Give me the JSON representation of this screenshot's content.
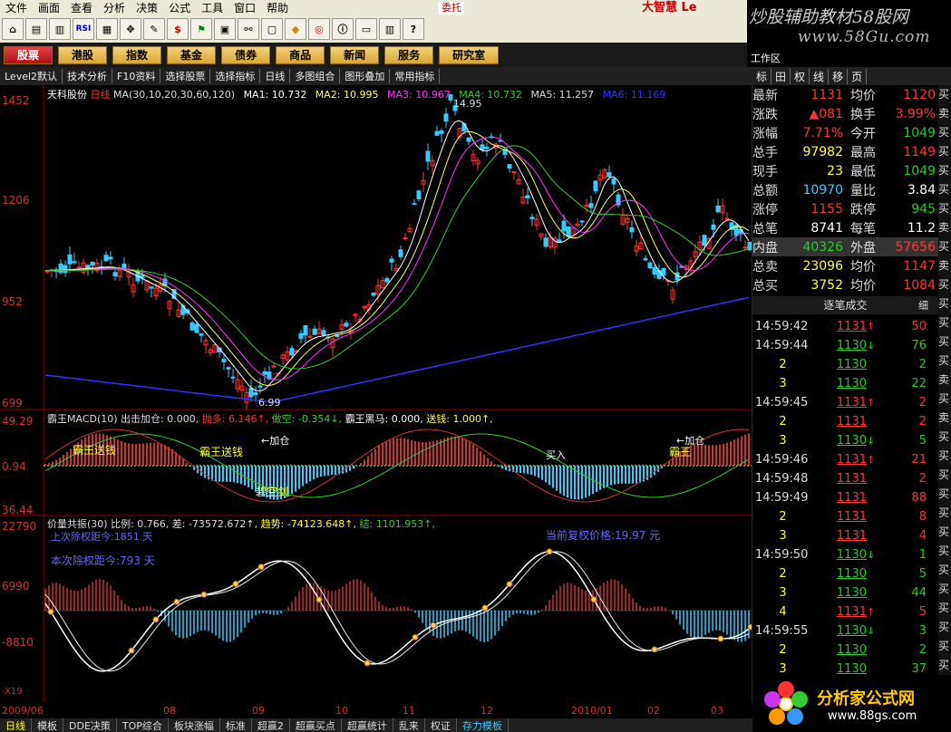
{
  "menu": [
    "文件",
    "画面",
    "查看",
    "分析",
    "决策",
    "公式",
    "工具",
    "窗口",
    "帮助"
  ],
  "trade_tab": "委托",
  "brand": "大智慧 Le",
  "watermark": {
    "line1": "炒股辅助教材58股网",
    "line2": "www.58Gu.com"
  },
  "nav": [
    "股票",
    "港股",
    "指数",
    "基金",
    "债券",
    "商品",
    "新闻",
    "服务",
    "研究室"
  ],
  "tabs": [
    "Level2默认",
    "技术分析",
    "F10资料",
    "选择股票",
    "选择指标",
    "日线",
    "多图组合",
    "图形叠加",
    "常用指标"
  ],
  "work_area": "工作区",
  "right_tabs": [
    "标",
    "田",
    "权",
    "线",
    "移",
    "页"
  ],
  "chart": {
    "stock": "天科股份",
    "period": "日线",
    "ma_spec": "MA(30,10,20,30,60,120)",
    "ma": [
      "MA1: 10.732",
      "MA2: 10.995",
      "MA3: 10.967",
      "MA4: 10.732",
      "MA5: 11.257",
      "MA6: 11.169"
    ],
    "y_labels": [
      "1452",
      "1206",
      "952",
      "699"
    ],
    "high_label": "14.95",
    "low_label": "6.99",
    "macd_title": "霸王MACD(10) 出击加仓: 0.000,",
    "macd_vals": [
      "抛多: 6.146↑,",
      "做空: -0.354↓,",
      "霸王黑马: 0.000,",
      "送钱: 1.000↑,"
    ],
    "macd_y": [
      "49.29",
      "0.94",
      "36.44"
    ],
    "macd_ann": [
      "霸王送钱",
      "霸王送钱",
      "←加仓",
      "碧空剑",
      "买入",
      "←加仓",
      "霸王"
    ],
    "vp_title": "价量共振(30) 比例: 0.766, 差: -73572.672↑,",
    "vp_vals": [
      "趋势: -74123.648↑,",
      "结: 1101.953↑,"
    ],
    "vp_y": [
      "22790",
      "6990",
      "-8810",
      "-X19"
    ],
    "vp_ann": [
      "上次除权距今:1851 天",
      "本次除权距今:793 天",
      "当前复权价格:19.97 元"
    ],
    "x_labels": [
      "2009/06",
      "08",
      "09",
      "10",
      "11",
      "12",
      "2010/01",
      "02",
      "03"
    ]
  },
  "quote": [
    [
      "最新",
      "1131",
      "均价",
      "1120"
    ],
    [
      "涨跌",
      "▲081",
      "换手",
      "3.99%"
    ],
    [
      "涨幅",
      "7.71%",
      "今开",
      "1049"
    ],
    [
      "总手",
      "97982",
      "最高",
      "1149"
    ],
    [
      "现手",
      "23",
      "最低",
      "1049"
    ],
    [
      "总额",
      "10970",
      "量比",
      "3.84"
    ],
    [
      "涨停",
      "1155",
      "跌停",
      "945"
    ],
    [
      "总笔",
      "8741",
      "每笔",
      "11.2"
    ],
    [
      "内盘",
      "40326",
      "外盘",
      "57656"
    ],
    [
      "总卖",
      "23096",
      "均价",
      "1147"
    ],
    [
      "总买",
      "3752",
      "均价",
      "1084"
    ]
  ],
  "tick_title": "逐笔成交",
  "tick_btn": "细",
  "ticks": [
    [
      "14:59:42",
      "1131",
      "↑",
      "50"
    ],
    [
      "14:59:44",
      "1130",
      "↓",
      "76"
    ],
    [
      "2",
      "1130",
      "",
      "2"
    ],
    [
      "3",
      "1130",
      "",
      "22"
    ],
    [
      "14:59:45",
      "1131",
      "↑",
      "2"
    ],
    [
      "2",
      "1131",
      "",
      "2"
    ],
    [
      "3",
      "1130",
      "↓",
      "5"
    ],
    [
      "14:59:46",
      "1131",
      "↑",
      "21"
    ],
    [
      "14:59:48",
      "1131",
      "",
      "2"
    ],
    [
      "14:59:49",
      "1131",
      "",
      "88"
    ],
    [
      "2",
      "1131",
      "",
      "8"
    ],
    [
      "3",
      "1131",
      "",
      "4"
    ],
    [
      "14:59:50",
      "1130",
      "↓",
      "1"
    ],
    [
      "2",
      "1130",
      "",
      "5"
    ],
    [
      "3",
      "1130",
      "",
      "44"
    ],
    [
      "4",
      "1131",
      "↑",
      "5"
    ],
    [
      "14:59:55",
      "1130",
      "↓",
      "3"
    ],
    [
      "2",
      "1130",
      "",
      "2"
    ],
    [
      "3",
      "1130",
      "",
      "37"
    ]
  ],
  "rstrip": [
    "买",
    "卖",
    "买",
    "买",
    "买",
    "买",
    "买",
    "卖",
    "买",
    "卖",
    "买",
    "买",
    "买",
    "买",
    "买",
    "卖",
    "买",
    "卖",
    "买",
    "买",
    "买",
    "买",
    "买",
    "买",
    "买",
    "买",
    "买",
    "买",
    "买",
    "买",
    "买",
    "买",
    "买"
  ],
  "bottom": [
    "日线",
    "模板",
    "DDE决策",
    "TOP综合",
    "板块涨幅",
    "标准",
    "超赢2",
    "超赢买点",
    "超赢统计",
    "乱来",
    "权证",
    "存力模板"
  ],
  "logo": {
    "name": "分析家公式网",
    "url": "www.88gs.com"
  }
}
